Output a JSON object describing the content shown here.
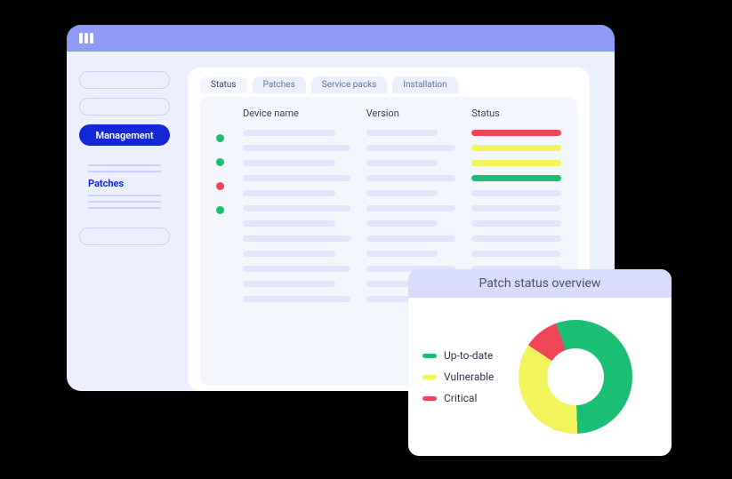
{
  "colors": {
    "green": "#1bbf74",
    "yellow": "#f1f45a",
    "red": "#ef4556"
  },
  "sidebar": {
    "active_label": "Management",
    "sub_active_label": "Patches"
  },
  "tabs": [
    {
      "label": "Status",
      "active": true
    },
    {
      "label": "Patches",
      "active": false
    },
    {
      "label": "Service packs",
      "active": false
    },
    {
      "label": "Installation",
      "active": false
    }
  ],
  "table": {
    "headers": {
      "name": "Device name",
      "version": "Version",
      "status": "Status"
    },
    "rows": [
      {
        "dot": "green",
        "status_color": "red"
      },
      {
        "dot": "green",
        "status_color": "yellow"
      },
      {
        "dot": "red",
        "status_color": "yellow"
      },
      {
        "dot": "green",
        "status_color": "green"
      }
    ]
  },
  "chart_data": {
    "type": "pie",
    "title": "Patch status overview",
    "series": [
      {
        "name": "Up-to-date",
        "value": 55,
        "color": "#1bbf74"
      },
      {
        "name": "Vulnerable",
        "value": 35,
        "color": "#f1f45a"
      },
      {
        "name": "Critical",
        "value": 10,
        "color": "#ef4556"
      }
    ]
  }
}
